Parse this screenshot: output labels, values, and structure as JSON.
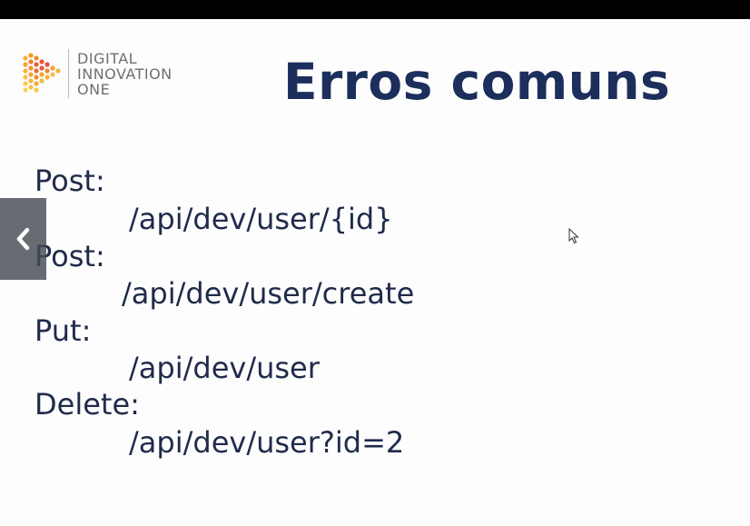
{
  "logo": {
    "line1": "DIGITAL",
    "line2": "INNOVATION",
    "line3": "ONE"
  },
  "slide": {
    "title": "Erros comuns",
    "lines": [
      "Post:",
      "/api/dev/user/{id}",
      "Post:",
      "/api/dev/user/create",
      "Put:",
      "/api/dev/user",
      "Delete:",
      "/api/dev/user?id=2"
    ]
  },
  "controls": {
    "prev_icon": "chevron-left-icon",
    "cursor_icon": "mouse-pointer-icon"
  },
  "colors": {
    "title": "#1c2f5c",
    "text": "#1f2b4a",
    "logo_text": "#6f6f6f",
    "logo_orange": "#f39a1e",
    "logo_red": "#e8553a",
    "top_bar": "#000000"
  }
}
